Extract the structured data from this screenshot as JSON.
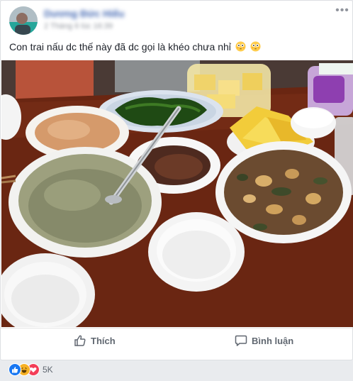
{
  "post": {
    "author_name": "Dương Đức Hiếu",
    "timestamp": "2 Tháng 6 lúc 16:39",
    "more_label": "•••",
    "caption": "Con trai nấu dc thế này đã dc gọi là khéo chưa nhỉ",
    "caption_emojis": [
      "flushed-face",
      "flushed-face"
    ]
  },
  "actions": {
    "like_label": "Thích",
    "comment_label": "Bình luận"
  },
  "reactions": {
    "types": [
      "like",
      "haha",
      "love"
    ],
    "count": "5K"
  },
  "colors": {
    "link_blue": "#4267b2",
    "like_blue": "#1877f2",
    "love_red": "#f33e58",
    "haha_yellow": "#f7b125",
    "action_gray": "#606770"
  }
}
